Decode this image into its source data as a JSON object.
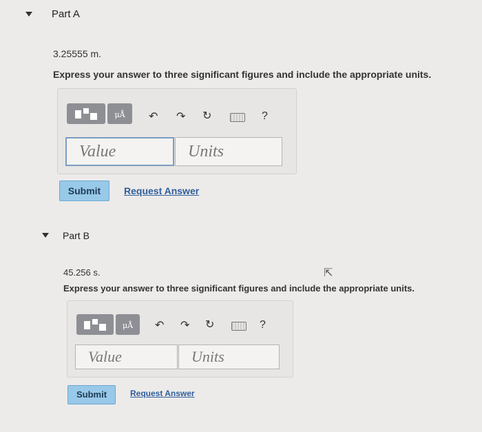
{
  "partA": {
    "title": "Part A",
    "prompt": "3.25555 m.",
    "instruction": "Express your answer to three significant figures and include the appropriate units.",
    "value_placeholder": "Value",
    "units_placeholder": "Units",
    "submit_label": "Submit",
    "request_label": "Request Answer",
    "help_label": "?",
    "units_tool_label": "μÅ"
  },
  "partB": {
    "title": "Part B",
    "prompt": "45.256 s.",
    "instruction": "Express your answer to three significant figures and include the appropriate units.",
    "value_placeholder": "Value",
    "units_placeholder": "Units",
    "submit_label": "Submit",
    "request_label": "Request Answer",
    "help_label": "?",
    "units_tool_label": "μÅ"
  },
  "icons": {
    "collapse": "caret-down-icon",
    "templates": "templates-icon",
    "units": "units-icon",
    "undo": "undo-icon",
    "redo": "redo-icon",
    "reset": "reset-icon",
    "keyboard": "keyboard-icon",
    "help": "help-icon"
  },
  "colors": {
    "submit_bg": "#98c9e8",
    "link": "#2f5e9a",
    "tool_bg": "#8e8f94"
  }
}
